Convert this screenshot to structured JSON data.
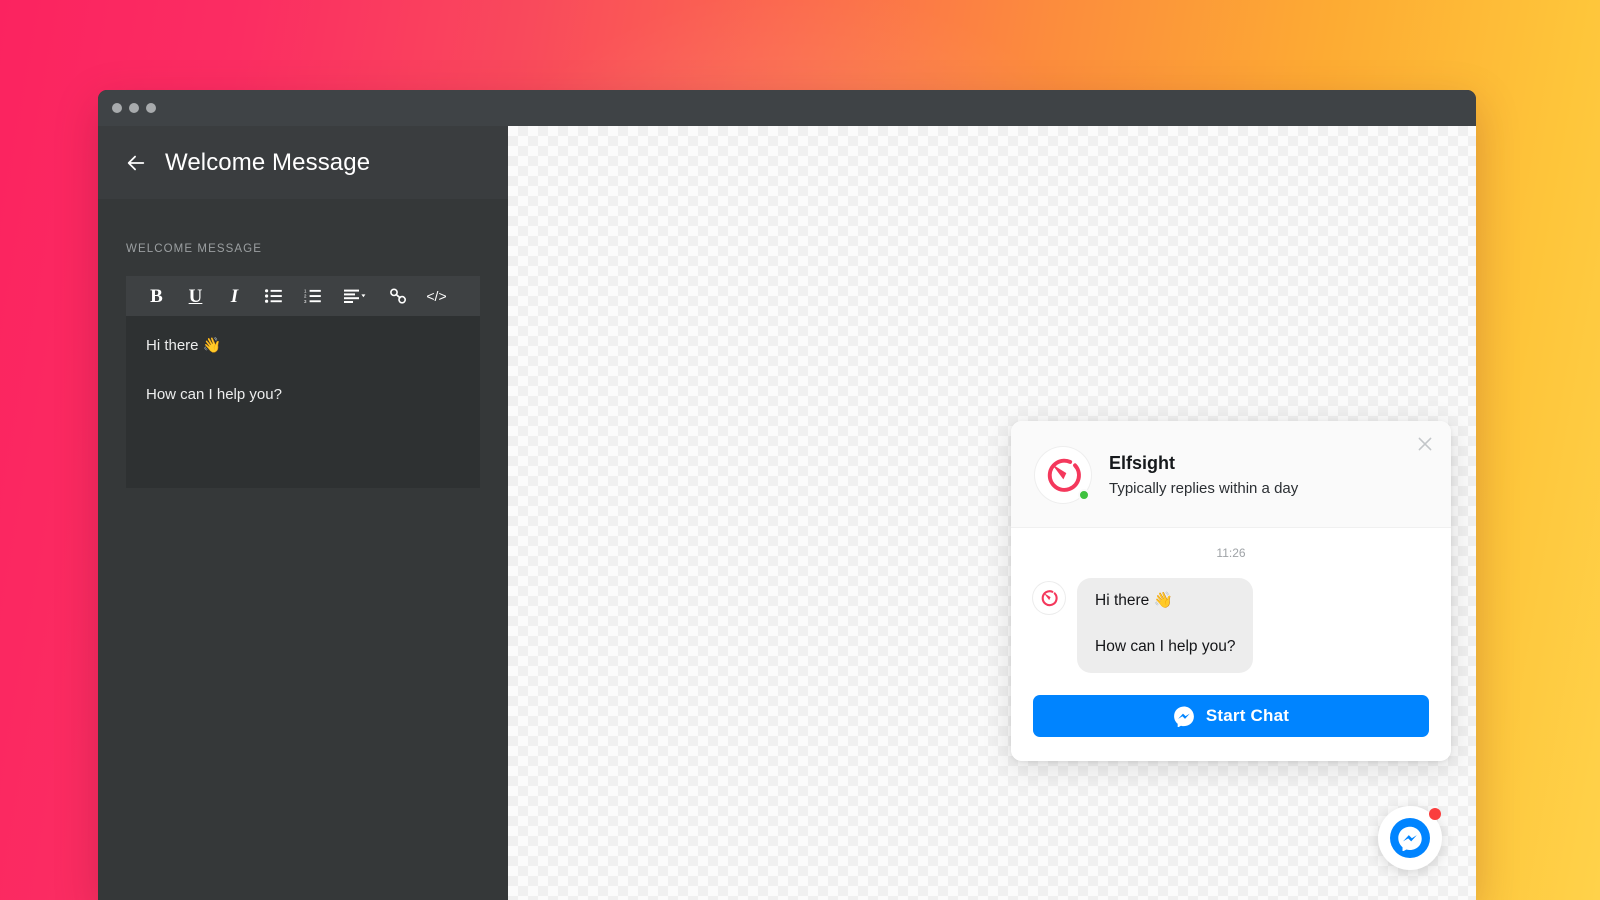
{
  "colors": {
    "accent_pink": "#fb2d62",
    "accent_orange": "#fc8c3d",
    "accent_yellow": "#ffd24a",
    "messenger_blue": "#0084ff",
    "online_green": "#3fc13f",
    "badge_red": "#fa3e3e",
    "sidebar_bg": "#353839",
    "editor_bg": "#2e3132",
    "toolbar_bg": "#3e4143"
  },
  "window": {
    "traffic_lights": [
      "close-dot",
      "minimize-dot",
      "maximize-dot"
    ]
  },
  "sidebar": {
    "back_icon": "arrow-left-icon",
    "title": "Welcome Message",
    "field_label": "WELCOME MESSAGE",
    "toolbar": [
      {
        "name": "bold-button",
        "icon": "bold-icon",
        "glyph": "B",
        "tooltip": "Bold"
      },
      {
        "name": "underline-button",
        "icon": "underline-icon",
        "glyph": "U",
        "tooltip": "Underline"
      },
      {
        "name": "italic-button",
        "icon": "italic-icon",
        "glyph": "I",
        "tooltip": "Italic"
      },
      {
        "name": "bullet-list-button",
        "icon": "unordered-list-icon",
        "glyph": "",
        "tooltip": "Bulleted list"
      },
      {
        "name": "numbered-list-button",
        "icon": "ordered-list-icon",
        "glyph": "",
        "tooltip": "Numbered list"
      },
      {
        "name": "align-button",
        "icon": "align-left-icon",
        "glyph": "",
        "tooltip": "Alignment"
      },
      {
        "name": "link-button",
        "icon": "link-icon",
        "glyph": "",
        "tooltip": "Insert link"
      },
      {
        "name": "code-button",
        "icon": "code-icon",
        "glyph": "</>",
        "tooltip": "Source code"
      }
    ],
    "editor_lines": [
      "Hi there 👋",
      "How can I help you?"
    ]
  },
  "chat_widget": {
    "close_icon": "close-icon",
    "avatar_icon": "elfsight-logo-icon",
    "name": "Elfsight",
    "subtitle": "Typically replies within a day",
    "status": "online",
    "timestamp": "11:26",
    "message_lines": [
      "Hi there 👋",
      "How can I help you?"
    ],
    "cta": {
      "icon": "messenger-icon",
      "label": "Start Chat"
    }
  },
  "floating_button": {
    "icon": "messenger-icon",
    "badge_visible": true
  }
}
